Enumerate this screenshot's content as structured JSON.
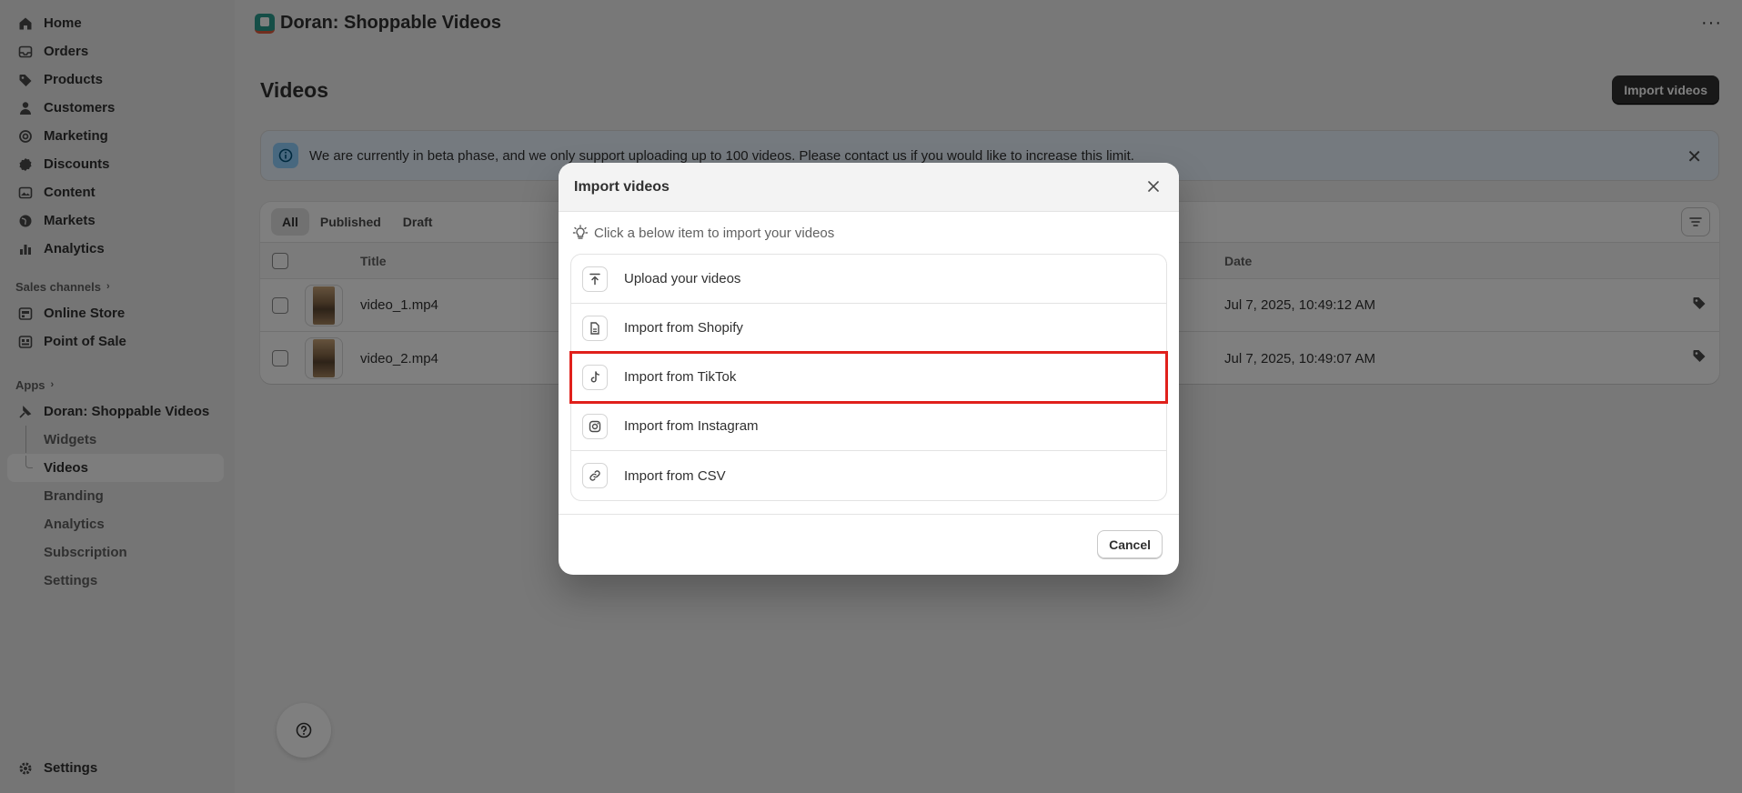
{
  "sidebar": {
    "nav": [
      {
        "label": "Home",
        "icon": "home-icon"
      },
      {
        "label": "Orders",
        "icon": "inbox-icon"
      },
      {
        "label": "Products",
        "icon": "tag-icon"
      },
      {
        "label": "Customers",
        "icon": "person-icon"
      },
      {
        "label": "Marketing",
        "icon": "target-icon"
      },
      {
        "label": "Discounts",
        "icon": "discount-icon"
      },
      {
        "label": "Content",
        "icon": "image-icon"
      },
      {
        "label": "Markets",
        "icon": "globe-icon"
      },
      {
        "label": "Analytics",
        "icon": "bar-chart-icon"
      }
    ],
    "sales_channels_label": "Sales channels",
    "channels": [
      {
        "label": "Online Store",
        "icon": "store-icon"
      },
      {
        "label": "Point of Sale",
        "icon": "pos-icon"
      }
    ],
    "apps_label": "Apps",
    "app_name": "Doran: Shoppable Videos",
    "app_sub": [
      {
        "label": "Widgets"
      },
      {
        "label": "Videos"
      },
      {
        "label": "Branding"
      },
      {
        "label": "Analytics"
      },
      {
        "label": "Subscription"
      },
      {
        "label": "Settings"
      }
    ],
    "settings_label": "Settings"
  },
  "header": {
    "app_title": "Doran: Shoppable Videos",
    "more": "···"
  },
  "page": {
    "title": "Videos",
    "import_button": "Import videos"
  },
  "banner": {
    "text": "We are currently in beta phase, and we only support uploading up to 100 videos. Please contact us if you would like to increase this limit."
  },
  "table": {
    "tabs": [
      "All",
      "Published",
      "Draft"
    ],
    "columns": {
      "title": "Title",
      "date": "Date"
    },
    "rows": [
      {
        "title": "video_1.mp4",
        "date": "Jul 7, 2025, 10:49:12 AM"
      },
      {
        "title": "video_2.mp4",
        "date": "Jul 7, 2025, 10:49:07 AM"
      }
    ]
  },
  "modal": {
    "title": "Import videos",
    "hint": "Click a below item to import your videos",
    "options": [
      {
        "label": "Upload your videos",
        "icon": "upload-icon"
      },
      {
        "label": "Import from Shopify",
        "icon": "file-icon"
      },
      {
        "label": "Import from TikTok",
        "icon": "tiktok-icon"
      },
      {
        "label": "Import from Instagram",
        "icon": "instagram-icon"
      },
      {
        "label": "Import from CSV",
        "icon": "link-icon"
      }
    ],
    "cancel": "Cancel"
  },
  "colors": {
    "highlight": "#e0201b",
    "primary_button": "#303030",
    "banner_bg": "#eaf4ff"
  }
}
